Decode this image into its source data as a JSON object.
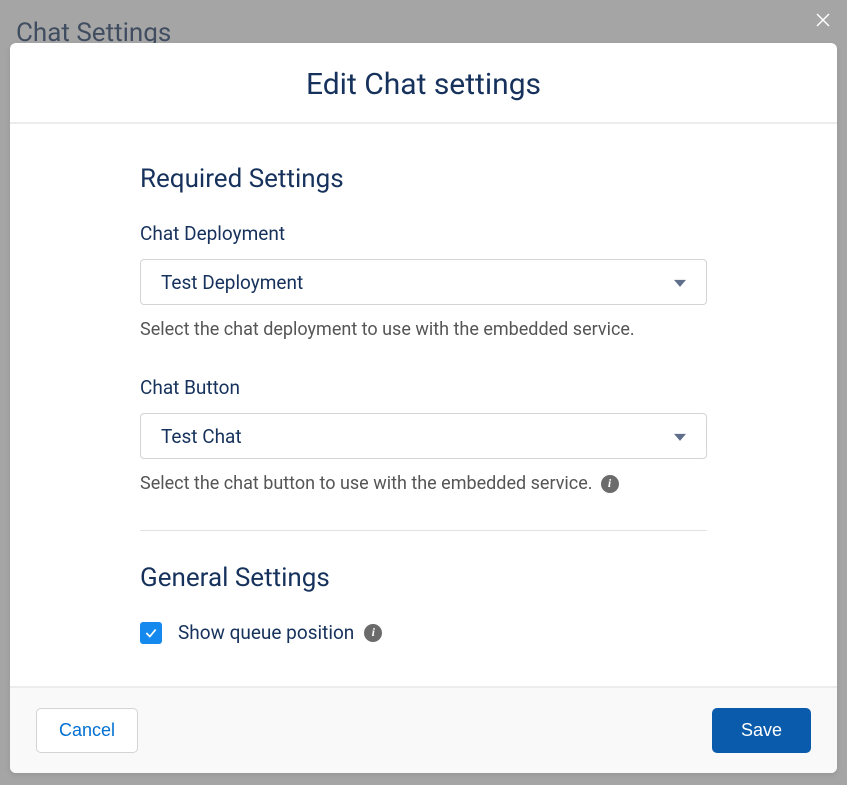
{
  "page": {
    "background_title": "Chat Settings"
  },
  "modal": {
    "title": "Edit Chat settings",
    "close_label": "Close"
  },
  "sections": {
    "required": {
      "heading": "Required Settings",
      "deployment": {
        "label": "Chat Deployment",
        "value": "Test Deployment",
        "help": "Select the chat deployment to use with the embedded service."
      },
      "button": {
        "label": "Chat Button",
        "value": "Test Chat",
        "help": "Select the chat button to use with the embedded service."
      }
    },
    "general": {
      "heading": "General Settings",
      "show_queue": {
        "label": "Show queue position",
        "checked": true
      }
    }
  },
  "footer": {
    "cancel": "Cancel",
    "save": "Save"
  },
  "colors": {
    "accent": "#1589ee",
    "primary_button": "#0b5bac",
    "link": "#0070d2"
  }
}
